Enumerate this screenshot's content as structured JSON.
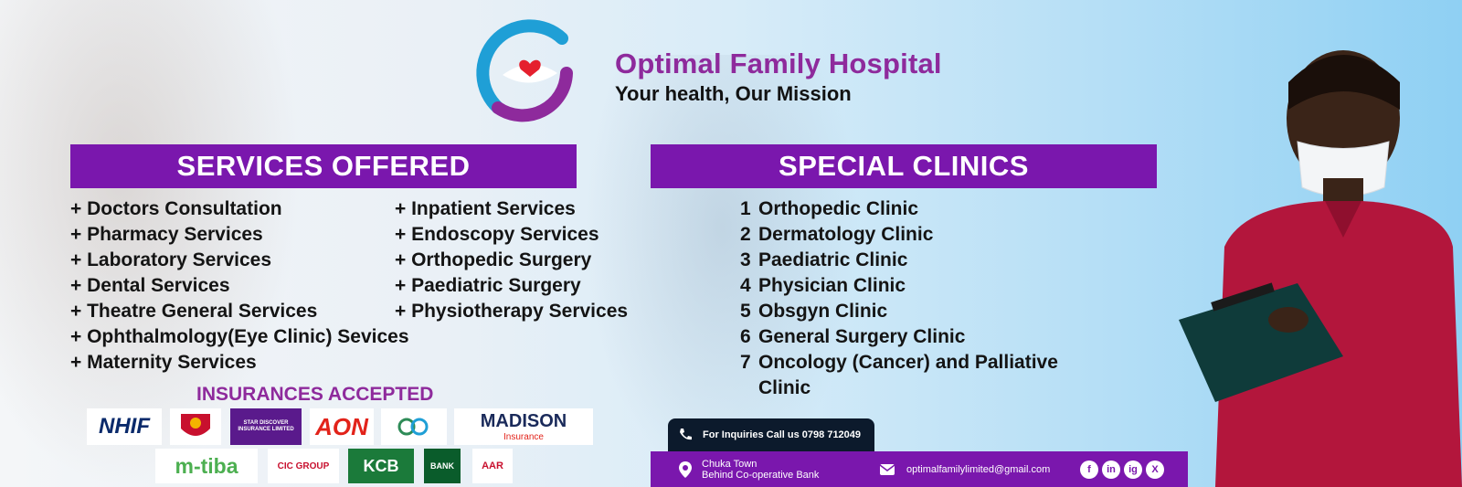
{
  "brand": {
    "name": "Optimal Family Hospital",
    "tagline": "Your health, Our Mission"
  },
  "services": {
    "title": "SERVICES OFFERED",
    "col1": [
      "+ Doctors Consultation",
      "+ Pharmacy Services",
      "+ Laboratory Services",
      "+ Dental Services",
      "+ Theatre General Services",
      "+ Ophthalmology(Eye Clinic) Sevices",
      "+ Maternity Services"
    ],
    "col2": [
      "+ Inpatient Services",
      "+ Endoscopy Services",
      "+ Orthopedic Surgery",
      "+ Paediatric Surgery",
      "+ Physiotherapy Services"
    ]
  },
  "clinics": {
    "title": "SPECIAL CLINICS",
    "items": [
      {
        "num": "1",
        "label": "Orthopedic Clinic"
      },
      {
        "num": "2",
        "label": "Dermatology Clinic"
      },
      {
        "num": "3",
        "label": "Paediatric Clinic"
      },
      {
        "num": "4",
        "label": "Physician Clinic"
      },
      {
        "num": "5",
        "label": "Obsgyn Clinic"
      },
      {
        "num": "6",
        "label": "General Surgery Clinic"
      },
      {
        "num": "7",
        "label": "Oncology (Cancer) and Palliative"
      },
      {
        "num": "",
        "label": "Clinic"
      }
    ]
  },
  "insurances": {
    "title": "INSURANCES ACCEPTED",
    "nhif": "NHIF",
    "star": "STAR DISCOVER INSURANCE LIMITED",
    "aon": "AON",
    "madison": "MADISON",
    "madison_sub": "Insurance",
    "mtiba": "m-tiba",
    "cic": "CIC GROUP",
    "kcb": "KCB",
    "coop": "BANK",
    "aar": "AAR"
  },
  "contact": {
    "inquiries": "For Inquiries Call us 0798 712049",
    "location_line1": "Chuka Town",
    "location_line2": "Behind Co-operative Bank",
    "email": "optimalfamilylimited@gmail.com"
  },
  "social": [
    "f",
    "in",
    "ig",
    "X"
  ],
  "colors": {
    "accent": "#7a17ad",
    "brand_text": "#8e2a9c",
    "logo_blue": "#1f9fd6",
    "logo_purple": "#8e2a9c",
    "heart": "#e5202e"
  }
}
